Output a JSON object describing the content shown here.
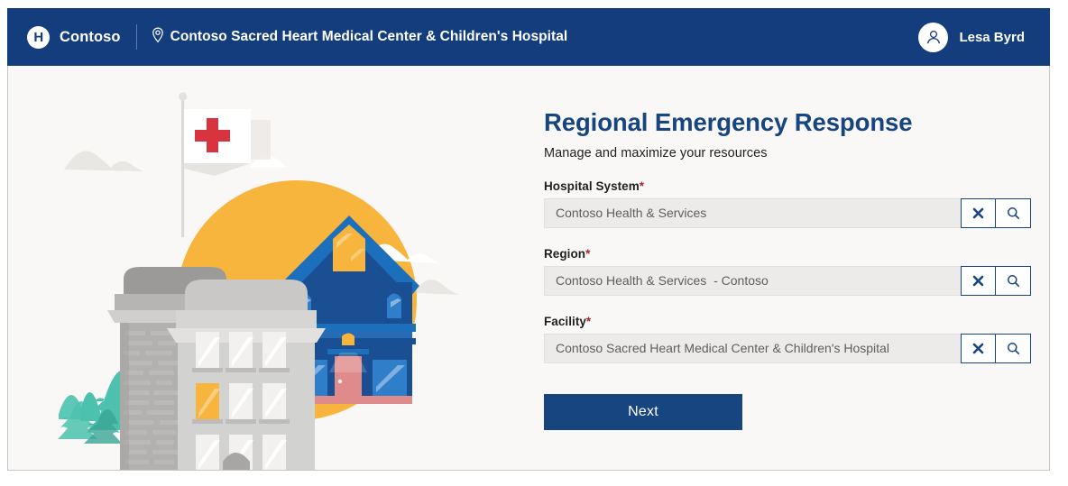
{
  "header": {
    "logo_letter": "H",
    "logo_icon": "hospital-logo-icon",
    "brand_name": "Contoso",
    "pin_icon": "location-pin-icon",
    "facility_name": "Contoso Sacred Heart Medical Center & Children's Hospital",
    "avatar_icon": "user-avatar-icon",
    "user_name": "Lesa Byrd"
  },
  "illustration": {
    "name": "hospital-city-illustration",
    "elements": [
      "sun",
      "cloud-left",
      "cloud-right",
      "red-cross-flag",
      "gray-hospital-building",
      "blue-house",
      "teal-trees"
    ],
    "colors": {
      "sun": "#f7b53e",
      "cloud": "#e8e6e3",
      "cross_red": "#d8343f",
      "building_gray": "#c9c8c6",
      "building_dark_gray": "#a8a7a5",
      "house_blue": "#1c6fbb",
      "house_dark_blue": "#1b4f93",
      "door_pink": "#e08b8b",
      "tree_teal": "#4cc2ae"
    }
  },
  "main": {
    "title": "Regional Emergency Response",
    "subtitle": "Manage and maximize your resources",
    "title_color": "#17457f",
    "fields": [
      {
        "label": "Hospital System",
        "required_marker": "*",
        "value": "Contoso Health & Services",
        "placeholder": "Contoso Health & Services",
        "clear_icon": "clear-x-icon",
        "search_icon": "search-magnifier-icon"
      },
      {
        "label": "Region",
        "required_marker": "*",
        "value": "Contoso Health & Services  - Contoso",
        "placeholder": "Contoso Health & Services  - Contoso",
        "clear_icon": "clear-x-icon",
        "search_icon": "search-magnifier-icon"
      },
      {
        "label": "Facility",
        "required_marker": "*",
        "value": "Contoso Sacred Heart Medical Center & Children's Hospital",
        "placeholder": "Contoso Sacred Heart Medical Center & Children's Hospital",
        "clear_icon": "clear-x-icon",
        "search_icon": "search-magnifier-icon"
      }
    ],
    "next_label": "Next",
    "accent_color": "#17457f",
    "required_color": "#a4262c"
  }
}
